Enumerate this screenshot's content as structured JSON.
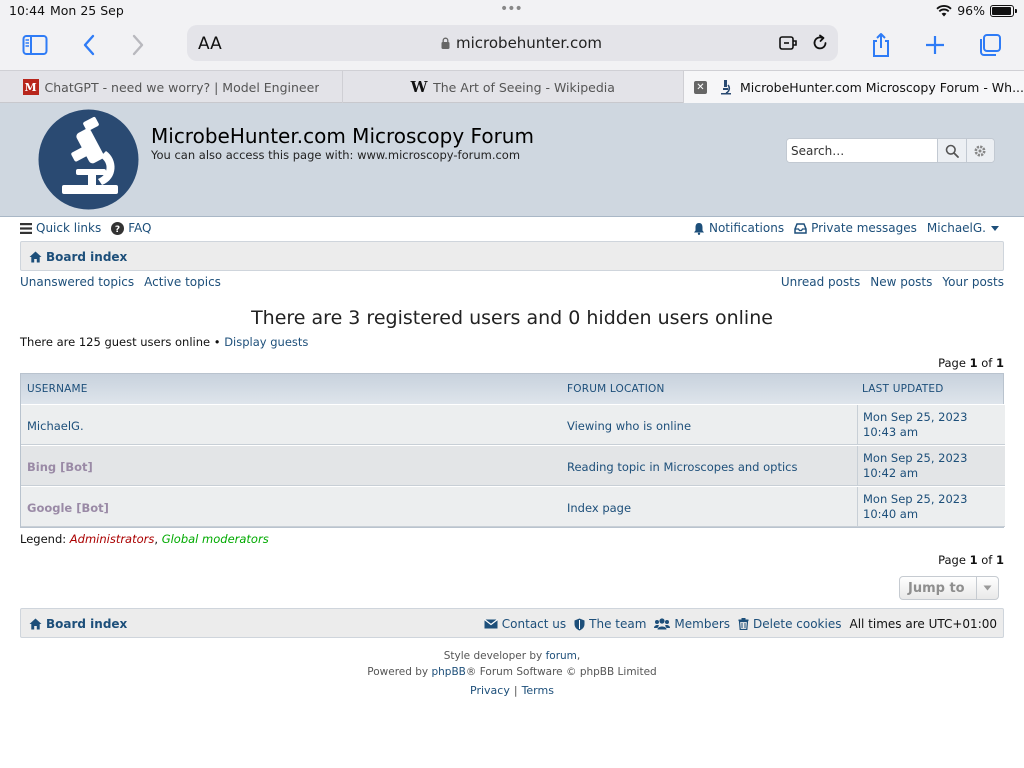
{
  "status": {
    "time": "10:44",
    "date": "Mon 25 Sep",
    "battery": "96%",
    "battery_level": 0.96
  },
  "browser": {
    "text_size_label": "AA",
    "url": "microbehunter.com",
    "tabs": [
      {
        "title": "ChatGPT - need we worry? | Model Engineer",
        "favicon": "M"
      },
      {
        "title": "The Art of Seeing - Wikipedia",
        "favicon": "W"
      },
      {
        "title": "MicrobeHunter.com Microscopy Forum - Wh..."
      }
    ]
  },
  "forum": {
    "title": "MicrobeHunter.com Microscopy Forum",
    "subtitle": "You can also access this page with: www.microscopy-forum.com",
    "search_placeholder": "Search…"
  },
  "nav": {
    "quick_links": "Quick links",
    "faq": "FAQ",
    "notifications": "Notifications",
    "private_messages": "Private messages",
    "username": "MichaelG."
  },
  "breadcrumb": {
    "board_index": "Board index"
  },
  "quick": {
    "unanswered": "Unanswered topics",
    "active": "Active topics",
    "unread": "Unread posts",
    "new": "New posts",
    "yours": "Your posts"
  },
  "page": {
    "headline": "There are 3 registered users and 0 hidden users online",
    "guest_text": "There are 125 guest users online •",
    "display_guests": "Display guests",
    "page_word": "Page",
    "page_current": "1",
    "page_of": "of",
    "page_total": "1"
  },
  "table": {
    "headers": {
      "username": "USERNAME",
      "location": "FORUM LOCATION",
      "updated": "LAST UPDATED"
    },
    "rows": [
      {
        "username": "MichaelG.",
        "location": "Viewing who is online",
        "date": "Mon Sep 25, 2023",
        "time": "10:43 am"
      },
      {
        "username": "Bing [Bot]",
        "location": "Reading topic in Microscopes and optics",
        "date": "Mon Sep 25, 2023",
        "time": "10:42 am"
      },
      {
        "username": "Google [Bot]",
        "location": "Index page",
        "date": "Mon Sep 25, 2023",
        "time": "10:40 am"
      }
    ]
  },
  "legend": {
    "label": "Legend:",
    "administrators": "Administrators",
    "comma": ",",
    "global_moderators": "Global moderators"
  },
  "jump": {
    "label": "Jump to"
  },
  "footer": {
    "board_index": "Board index",
    "contact": "Contact us",
    "team": "The team",
    "members": "Members",
    "delete_cookies": "Delete cookies",
    "timezone": "All times are UTC+01:00",
    "style_text": "Style developer by",
    "style_link": "forum",
    "style_end": ",",
    "powered_text": "Powered by",
    "phpbb": "phpBB",
    "powered_end": "® Forum Software © phpBB Limited",
    "privacy": "Privacy",
    "divider": "|",
    "terms": "Terms"
  },
  "colors": {
    "link": "#1d4f7a",
    "header_bg": "#cfd7e0",
    "logo_circle": "#2a4a72",
    "admin": "#aa0000",
    "moderator": "#00aa00",
    "bot": "#9a8aa6"
  }
}
